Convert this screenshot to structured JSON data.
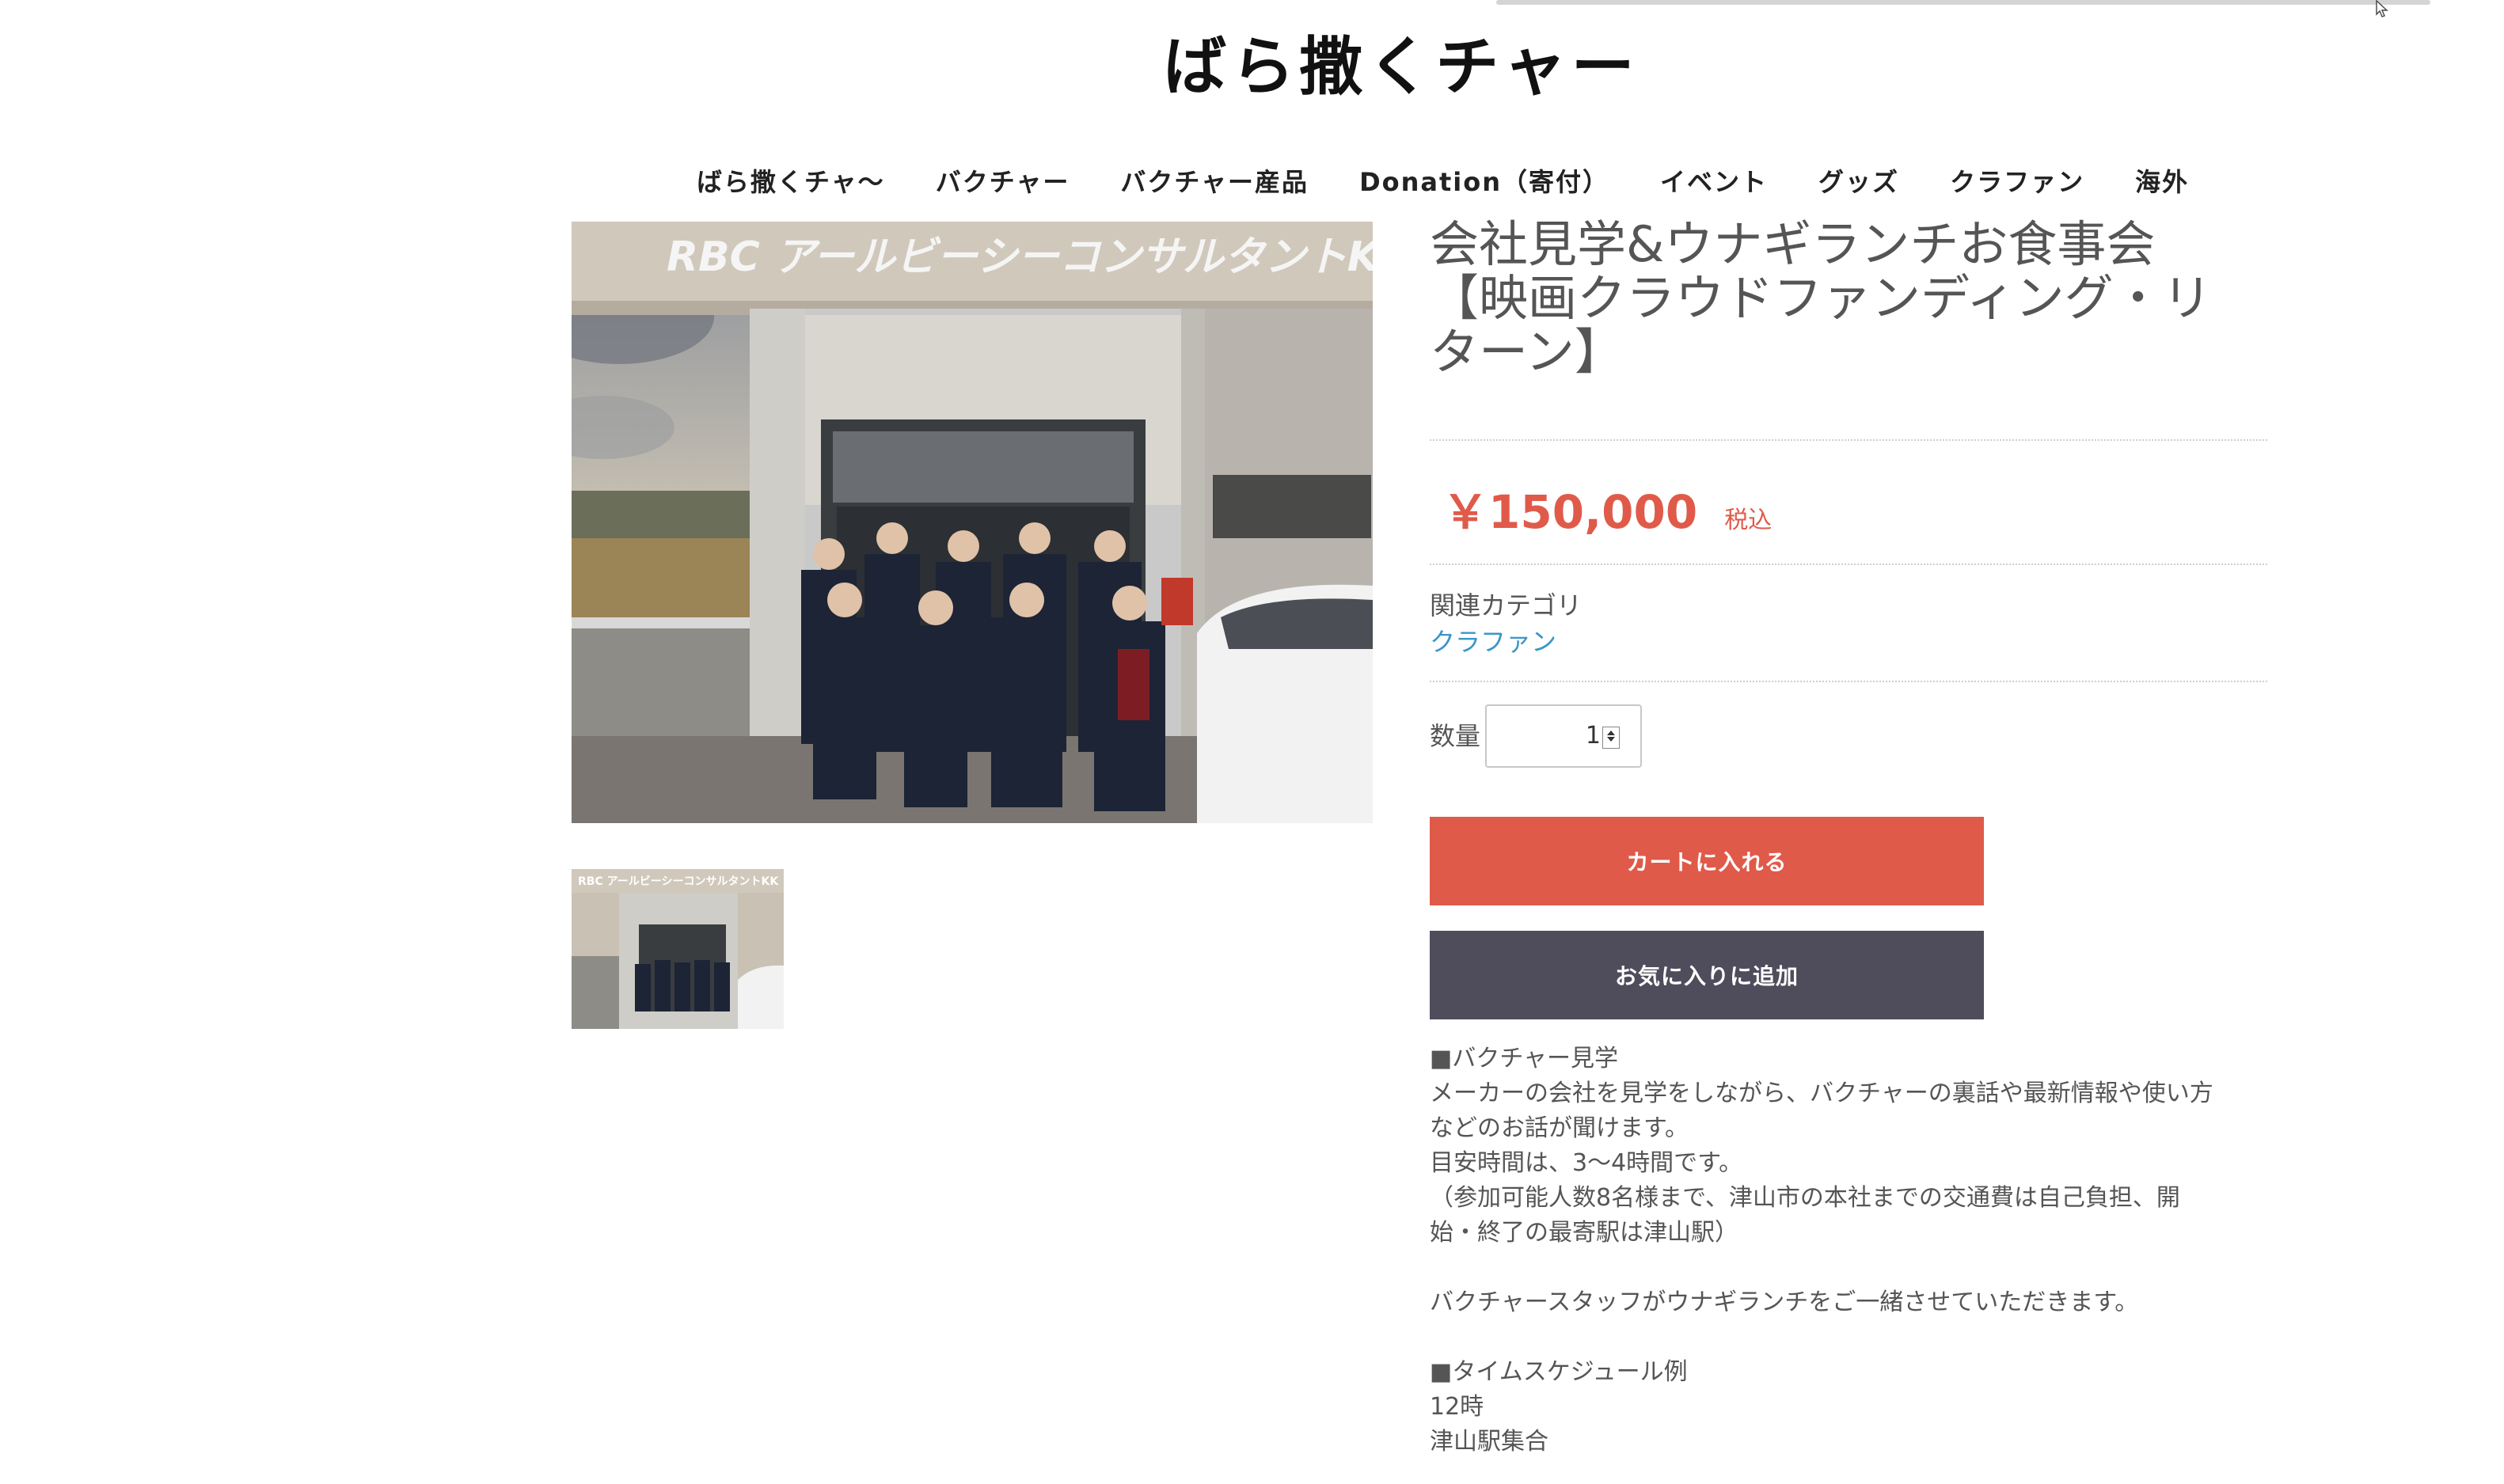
{
  "site": {
    "title": "ばら撒くチャー"
  },
  "nav": {
    "items": [
      "ばら撒くチャ〜",
      "バクチャー",
      "バクチャー産品",
      "Donation（寄付）",
      "イベント",
      "グッズ",
      "クラファン",
      "海外"
    ]
  },
  "product": {
    "title_lines": [
      "会社見学&ウナギランチお食事会",
      "【映画クラウドファンディング・リ",
      "ターン】"
    ],
    "price": "￥150,000",
    "tax_label": "税込",
    "category_label": "関連カテゴリ",
    "category_link": "クラファン",
    "quantity_label": "数量",
    "quantity_value": "1",
    "cart_button": "カートに入れる",
    "favorite_button": "お気に入りに追加",
    "photo_sign": "RBC アールビーシーコンサルタントKK",
    "description_lines": [
      "■バクチャー見学",
      "メーカーの会社を見学をしながら、バクチャーの裏話や最新情報や使い方",
      "などのお話が聞けます。",
      "目安時間は、3〜4時間です。",
      "（参加可能人数8名様まで、津山市の本社までの交通費は自己負担、開",
      "始・終了の最寄駅は津山駅）",
      "",
      "バクチャースタッフがウナギランチをご一緒させていただきます。",
      "",
      "■タイムスケジュール例",
      "12時",
      "津山駅集合"
    ]
  },
  "colors": {
    "accent": "#e05a4a",
    "secondary_button": "#4f4d5c",
    "link": "#3a96c8"
  },
  "icons": [
    "mouse-cursor-icon",
    "spinner-up-icon",
    "spinner-down-icon"
  ]
}
